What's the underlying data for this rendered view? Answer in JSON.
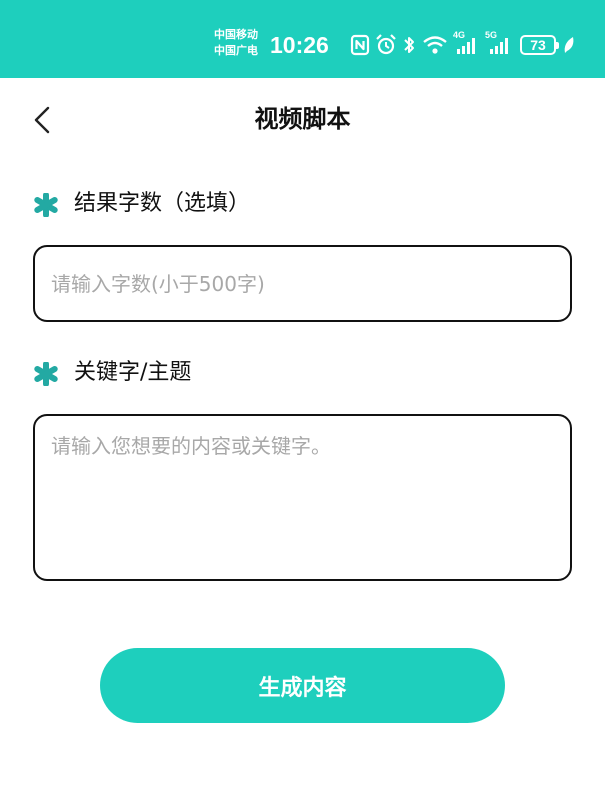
{
  "status_bar": {
    "carrier_1": "中国移动",
    "carrier_2": "中国广电",
    "time": "10:26",
    "signal_1_label": "4G",
    "signal_2_label": "5G",
    "battery": "73",
    "icons": [
      "nfc-icon",
      "alarm-icon",
      "bluetooth-icon",
      "wifi-icon",
      "signal-4g-icon",
      "signal-5g-icon",
      "battery-icon",
      "leaf-icon"
    ],
    "background_color": "#1ecfbd"
  },
  "header": {
    "title": "视频脚本",
    "back_icon": "chevron-left-icon"
  },
  "form": {
    "count_field": {
      "label": "结果字数（选填）",
      "placeholder": "请输入字数(小于500字)",
      "value": ""
    },
    "keyword_field": {
      "label": "关键字/主题",
      "placeholder": "请输入您想要的内容或关键字。",
      "value": ""
    },
    "required_icon": "asterisk-icon",
    "required_icon_color": "#23a9a3"
  },
  "actions": {
    "generate_label": "生成内容",
    "accent_color": "#1ecfbd"
  }
}
